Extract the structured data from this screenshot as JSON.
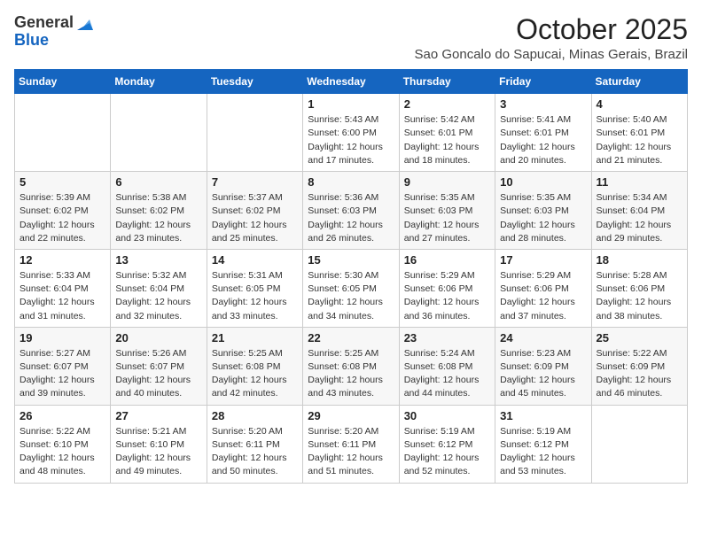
{
  "logo": {
    "general": "General",
    "blue": "Blue"
  },
  "title": {
    "month_year": "October 2025",
    "location": "Sao Goncalo do Sapucai, Minas Gerais, Brazil"
  },
  "days_of_week": [
    "Sunday",
    "Monday",
    "Tuesday",
    "Wednesday",
    "Thursday",
    "Friday",
    "Saturday"
  ],
  "weeks": [
    [
      {
        "day": "",
        "info": ""
      },
      {
        "day": "",
        "info": ""
      },
      {
        "day": "",
        "info": ""
      },
      {
        "day": "1",
        "info": "Sunrise: 5:43 AM\nSunset: 6:00 PM\nDaylight: 12 hours\nand 17 minutes."
      },
      {
        "day": "2",
        "info": "Sunrise: 5:42 AM\nSunset: 6:01 PM\nDaylight: 12 hours\nand 18 minutes."
      },
      {
        "day": "3",
        "info": "Sunrise: 5:41 AM\nSunset: 6:01 PM\nDaylight: 12 hours\nand 20 minutes."
      },
      {
        "day": "4",
        "info": "Sunrise: 5:40 AM\nSunset: 6:01 PM\nDaylight: 12 hours\nand 21 minutes."
      }
    ],
    [
      {
        "day": "5",
        "info": "Sunrise: 5:39 AM\nSunset: 6:02 PM\nDaylight: 12 hours\nand 22 minutes."
      },
      {
        "day": "6",
        "info": "Sunrise: 5:38 AM\nSunset: 6:02 PM\nDaylight: 12 hours\nand 23 minutes."
      },
      {
        "day": "7",
        "info": "Sunrise: 5:37 AM\nSunset: 6:02 PM\nDaylight: 12 hours\nand 25 minutes."
      },
      {
        "day": "8",
        "info": "Sunrise: 5:36 AM\nSunset: 6:03 PM\nDaylight: 12 hours\nand 26 minutes."
      },
      {
        "day": "9",
        "info": "Sunrise: 5:35 AM\nSunset: 6:03 PM\nDaylight: 12 hours\nand 27 minutes."
      },
      {
        "day": "10",
        "info": "Sunrise: 5:35 AM\nSunset: 6:03 PM\nDaylight: 12 hours\nand 28 minutes."
      },
      {
        "day": "11",
        "info": "Sunrise: 5:34 AM\nSunset: 6:04 PM\nDaylight: 12 hours\nand 29 minutes."
      }
    ],
    [
      {
        "day": "12",
        "info": "Sunrise: 5:33 AM\nSunset: 6:04 PM\nDaylight: 12 hours\nand 31 minutes."
      },
      {
        "day": "13",
        "info": "Sunrise: 5:32 AM\nSunset: 6:04 PM\nDaylight: 12 hours\nand 32 minutes."
      },
      {
        "day": "14",
        "info": "Sunrise: 5:31 AM\nSunset: 6:05 PM\nDaylight: 12 hours\nand 33 minutes."
      },
      {
        "day": "15",
        "info": "Sunrise: 5:30 AM\nSunset: 6:05 PM\nDaylight: 12 hours\nand 34 minutes."
      },
      {
        "day": "16",
        "info": "Sunrise: 5:29 AM\nSunset: 6:06 PM\nDaylight: 12 hours\nand 36 minutes."
      },
      {
        "day": "17",
        "info": "Sunrise: 5:29 AM\nSunset: 6:06 PM\nDaylight: 12 hours\nand 37 minutes."
      },
      {
        "day": "18",
        "info": "Sunrise: 5:28 AM\nSunset: 6:06 PM\nDaylight: 12 hours\nand 38 minutes."
      }
    ],
    [
      {
        "day": "19",
        "info": "Sunrise: 5:27 AM\nSunset: 6:07 PM\nDaylight: 12 hours\nand 39 minutes."
      },
      {
        "day": "20",
        "info": "Sunrise: 5:26 AM\nSunset: 6:07 PM\nDaylight: 12 hours\nand 40 minutes."
      },
      {
        "day": "21",
        "info": "Sunrise: 5:25 AM\nSunset: 6:08 PM\nDaylight: 12 hours\nand 42 minutes."
      },
      {
        "day": "22",
        "info": "Sunrise: 5:25 AM\nSunset: 6:08 PM\nDaylight: 12 hours\nand 43 minutes."
      },
      {
        "day": "23",
        "info": "Sunrise: 5:24 AM\nSunset: 6:08 PM\nDaylight: 12 hours\nand 44 minutes."
      },
      {
        "day": "24",
        "info": "Sunrise: 5:23 AM\nSunset: 6:09 PM\nDaylight: 12 hours\nand 45 minutes."
      },
      {
        "day": "25",
        "info": "Sunrise: 5:22 AM\nSunset: 6:09 PM\nDaylight: 12 hours\nand 46 minutes."
      }
    ],
    [
      {
        "day": "26",
        "info": "Sunrise: 5:22 AM\nSunset: 6:10 PM\nDaylight: 12 hours\nand 48 minutes."
      },
      {
        "day": "27",
        "info": "Sunrise: 5:21 AM\nSunset: 6:10 PM\nDaylight: 12 hours\nand 49 minutes."
      },
      {
        "day": "28",
        "info": "Sunrise: 5:20 AM\nSunset: 6:11 PM\nDaylight: 12 hours\nand 50 minutes."
      },
      {
        "day": "29",
        "info": "Sunrise: 5:20 AM\nSunset: 6:11 PM\nDaylight: 12 hours\nand 51 minutes."
      },
      {
        "day": "30",
        "info": "Sunrise: 5:19 AM\nSunset: 6:12 PM\nDaylight: 12 hours\nand 52 minutes."
      },
      {
        "day": "31",
        "info": "Sunrise: 5:19 AM\nSunset: 6:12 PM\nDaylight: 12 hours\nand 53 minutes."
      },
      {
        "day": "",
        "info": ""
      }
    ]
  ]
}
